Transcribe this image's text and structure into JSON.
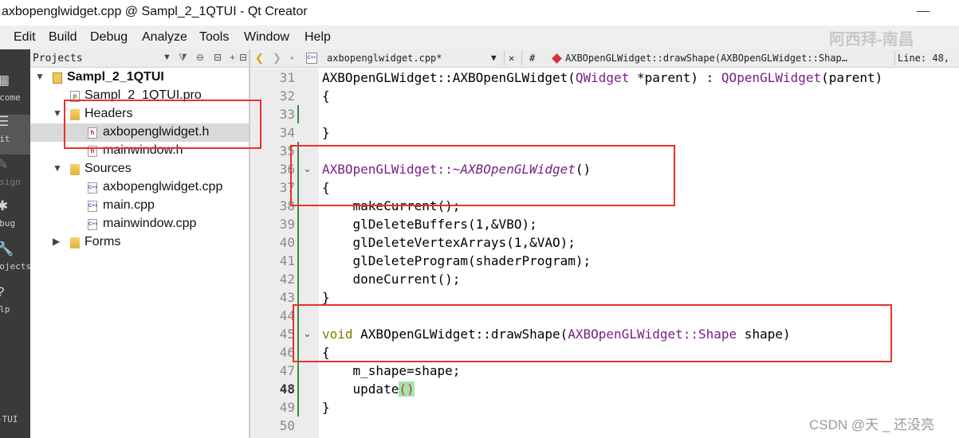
{
  "window": {
    "title": "axbopenglwidget.cpp @ Sampl_2_1QTUI - Qt Creator"
  },
  "menu": [
    "Edit",
    "Build",
    "Debug",
    "Analyze",
    "Tools",
    "Window",
    "Help"
  ],
  "watermark_top": "阿西拜-南昌",
  "modes": [
    {
      "label": "elcome",
      "icon": "grid-icon"
    },
    {
      "label": "Edit",
      "icon": "edit-icon"
    },
    {
      "label": "Design",
      "icon": "design-icon"
    },
    {
      "label": "Debug",
      "icon": "bug-icon"
    },
    {
      "label": "Projects",
      "icon": "wrench-icon"
    },
    {
      "label": "Help",
      "icon": "help-icon"
    }
  ],
  "kit_label": "-TUI",
  "projects_pane": {
    "selector": "Projects",
    "tree": [
      {
        "label": "Sampl_2_1QTUI",
        "bold": true
      },
      {
        "label": "Sampl_2_1QTUI.pro"
      },
      {
        "label": "Headers"
      },
      {
        "label": "axbopenglwidget.h"
      },
      {
        "label": "mainwindow.h"
      },
      {
        "label": "Sources"
      },
      {
        "label": "axbopenglwidget.cpp"
      },
      {
        "label": "main.cpp"
      },
      {
        "label": "mainwindow.cpp"
      },
      {
        "label": "Forms"
      }
    ]
  },
  "editor_header": {
    "file_tab": "axbopenglwidget.cpp*",
    "hash": "#",
    "symbol": "AXBOpenGLWidget::drawShape(AXBOpenGLWidget::Shap…",
    "line_info": "Line: 48,"
  },
  "code": {
    "line_numbers": [
      "31",
      "32",
      "33",
      "34",
      "35",
      "36",
      "37",
      "38",
      "39",
      "40",
      "41",
      "42",
      "43",
      "44",
      "45",
      "46",
      "47",
      "48",
      "49",
      "50"
    ],
    "l31": {
      "a": "AXBOpenGLWidget::AXBOpenGLWidget(",
      "b": "QWidget",
      "c": " *parent) : ",
      "d": "QOpenGLWidget",
      "e": "(parent)"
    },
    "l32": "{",
    "l34": "}",
    "l36": {
      "a": "AXBOpenGLWidget::",
      "b": "~AXBOpenGLWidget",
      "c": "()"
    },
    "l37": "{",
    "l38": "    makeCurrent();",
    "l39": "    glDeleteBuffers(1,&VBO);",
    "l40": "    glDeleteVertexArrays(1,&VAO);",
    "l41": "    glDeleteProgram(shaderProgram);",
    "l42": "    doneCurrent();",
    "l43": "}",
    "l45": {
      "kw": "void",
      "a": " AXBOpenGLWidget::drawShape(",
      "b": "AXBOpenGLWidget::Shape",
      "c": " shape)"
    },
    "l46": "{",
    "l47": "    m_shape=shape;",
    "l48": {
      "a": "    update",
      "b": "()"
    },
    "l49": "}"
  },
  "watermark_bottom": "CSDN @天 _ 还没亮"
}
